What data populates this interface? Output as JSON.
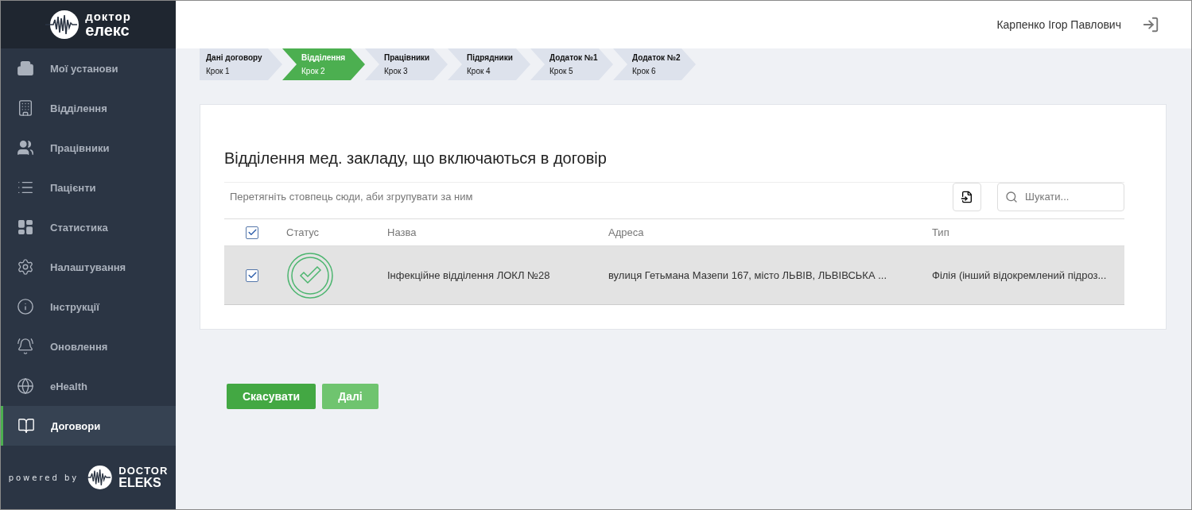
{
  "logo": {
    "line_1": "доктор",
    "line_2": "елекс"
  },
  "sidebar": {
    "items": [
      {
        "label": "Мої установи",
        "selected": false
      },
      {
        "label": "Відділення",
        "selected": false
      },
      {
        "label": "Працівники",
        "selected": false
      },
      {
        "label": "Пацієнти",
        "selected": false
      },
      {
        "label": "Статистика",
        "selected": false
      },
      {
        "label": "Налаштування",
        "selected": false
      },
      {
        "label": "Інструкції",
        "selected": false
      },
      {
        "label": "Оновлення",
        "selected": false
      },
      {
        "label": "eHealth",
        "selected": false
      },
      {
        "label": "Договори",
        "selected": true
      }
    ],
    "footer": {
      "text": "powered by",
      "brand_1": "DOCTOR",
      "brand_2": "ELEKS"
    }
  },
  "header": {
    "user": "Карпенко Ігор Павлович"
  },
  "steps": [
    {
      "title": "Дані договору",
      "step": "Крок 1",
      "selected": false
    },
    {
      "title": "Відділення",
      "step": "Крок 2",
      "selected": true
    },
    {
      "title": "Працівники",
      "step": "Крок 3",
      "selected": false
    },
    {
      "title": "Підрядники",
      "step": "Крок 4",
      "selected": false
    },
    {
      "title": "Додаток №1",
      "step": "Крок 5",
      "selected": false
    },
    {
      "title": "Додаток №2",
      "step": "Крок 6",
      "selected": false
    }
  ],
  "panel": {
    "title": "Відділення мед. закладу, що включаються в договір",
    "group_hint": "Перетягніть стовпець сюди, аби згрупувати за ним",
    "search": {
      "placeholder": "Шукати..."
    },
    "table": {
      "all_checked": true,
      "columns": [
        "Статус",
        "Назва",
        "Адреса",
        "Тип"
      ],
      "rows": [
        {
          "checked": true,
          "name": "Інфекційне відділення ЛОКЛ №28",
          "address": "вулиця Гетьмана Мазепи 167, місто ЛЬВІВ, ЛЬВІВСЬКА ...",
          "type": "Філія (інший відокремлений підроз..."
        }
      ]
    }
  },
  "buttons": [
    {
      "label": "Скасувати",
      "kind": "primary"
    },
    {
      "label": "Далі",
      "kind": "light"
    }
  ]
}
